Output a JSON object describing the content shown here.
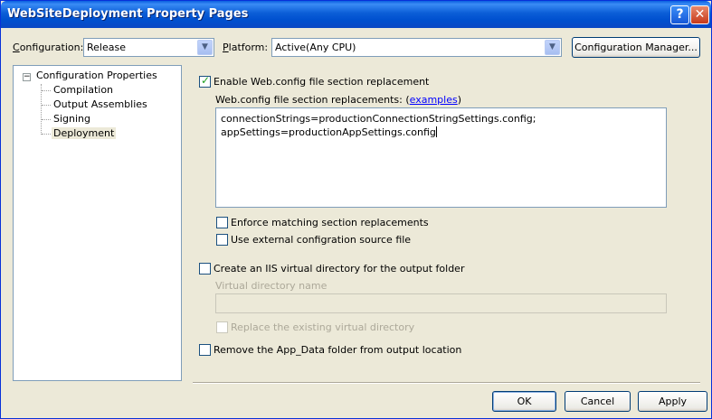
{
  "window": {
    "title": "WebSiteDeployment Property Pages",
    "help_glyph": "?",
    "close_glyph": "✕"
  },
  "toolbar": {
    "configuration_label": "Configuration:",
    "configuration_value": "Release",
    "platform_label": "Platform:",
    "platform_value": "Active(Any CPU)",
    "config_manager_label": "Configuration Manager..."
  },
  "tree": {
    "root": "Configuration Properties",
    "items": [
      "Compilation",
      "Output Assemblies",
      "Signing",
      "Deployment"
    ],
    "selected": "Deployment",
    "expander_glyph": "−"
  },
  "deployment": {
    "enable_webconfig_label": "Enable Web.config file section replacement",
    "enable_webconfig_checked": true,
    "replacements_label_prefix": "Web.config file section replacements: (",
    "replacements_link": "examples",
    "replacements_label_suffix": ")",
    "replacements_text": "connectionStrings=productionConnectionStringSettings.config;\nappSettings=productionAppSettings.config",
    "enforce_label": "Enforce matching section replacements",
    "enforce_checked": false,
    "external_label": "Use external configration source file",
    "external_checked": false,
    "iis_label": "Create an IIS virtual directory for the output folder",
    "iis_checked": false,
    "vdir_name_label": "Virtual directory name",
    "vdir_name_value": "",
    "replace_vdir_label": "Replace the existing virtual directory",
    "replace_vdir_checked": false,
    "remove_appdata_label": "Remove the App_Data folder from output location",
    "remove_appdata_checked": false
  },
  "buttons": {
    "ok": "OK",
    "cancel": "Cancel",
    "apply": "Apply"
  },
  "colors": {
    "titlebar": "#0054e3",
    "dialog_bg": "#ece9d8",
    "link": "#0000ff",
    "check": "#21a121"
  }
}
